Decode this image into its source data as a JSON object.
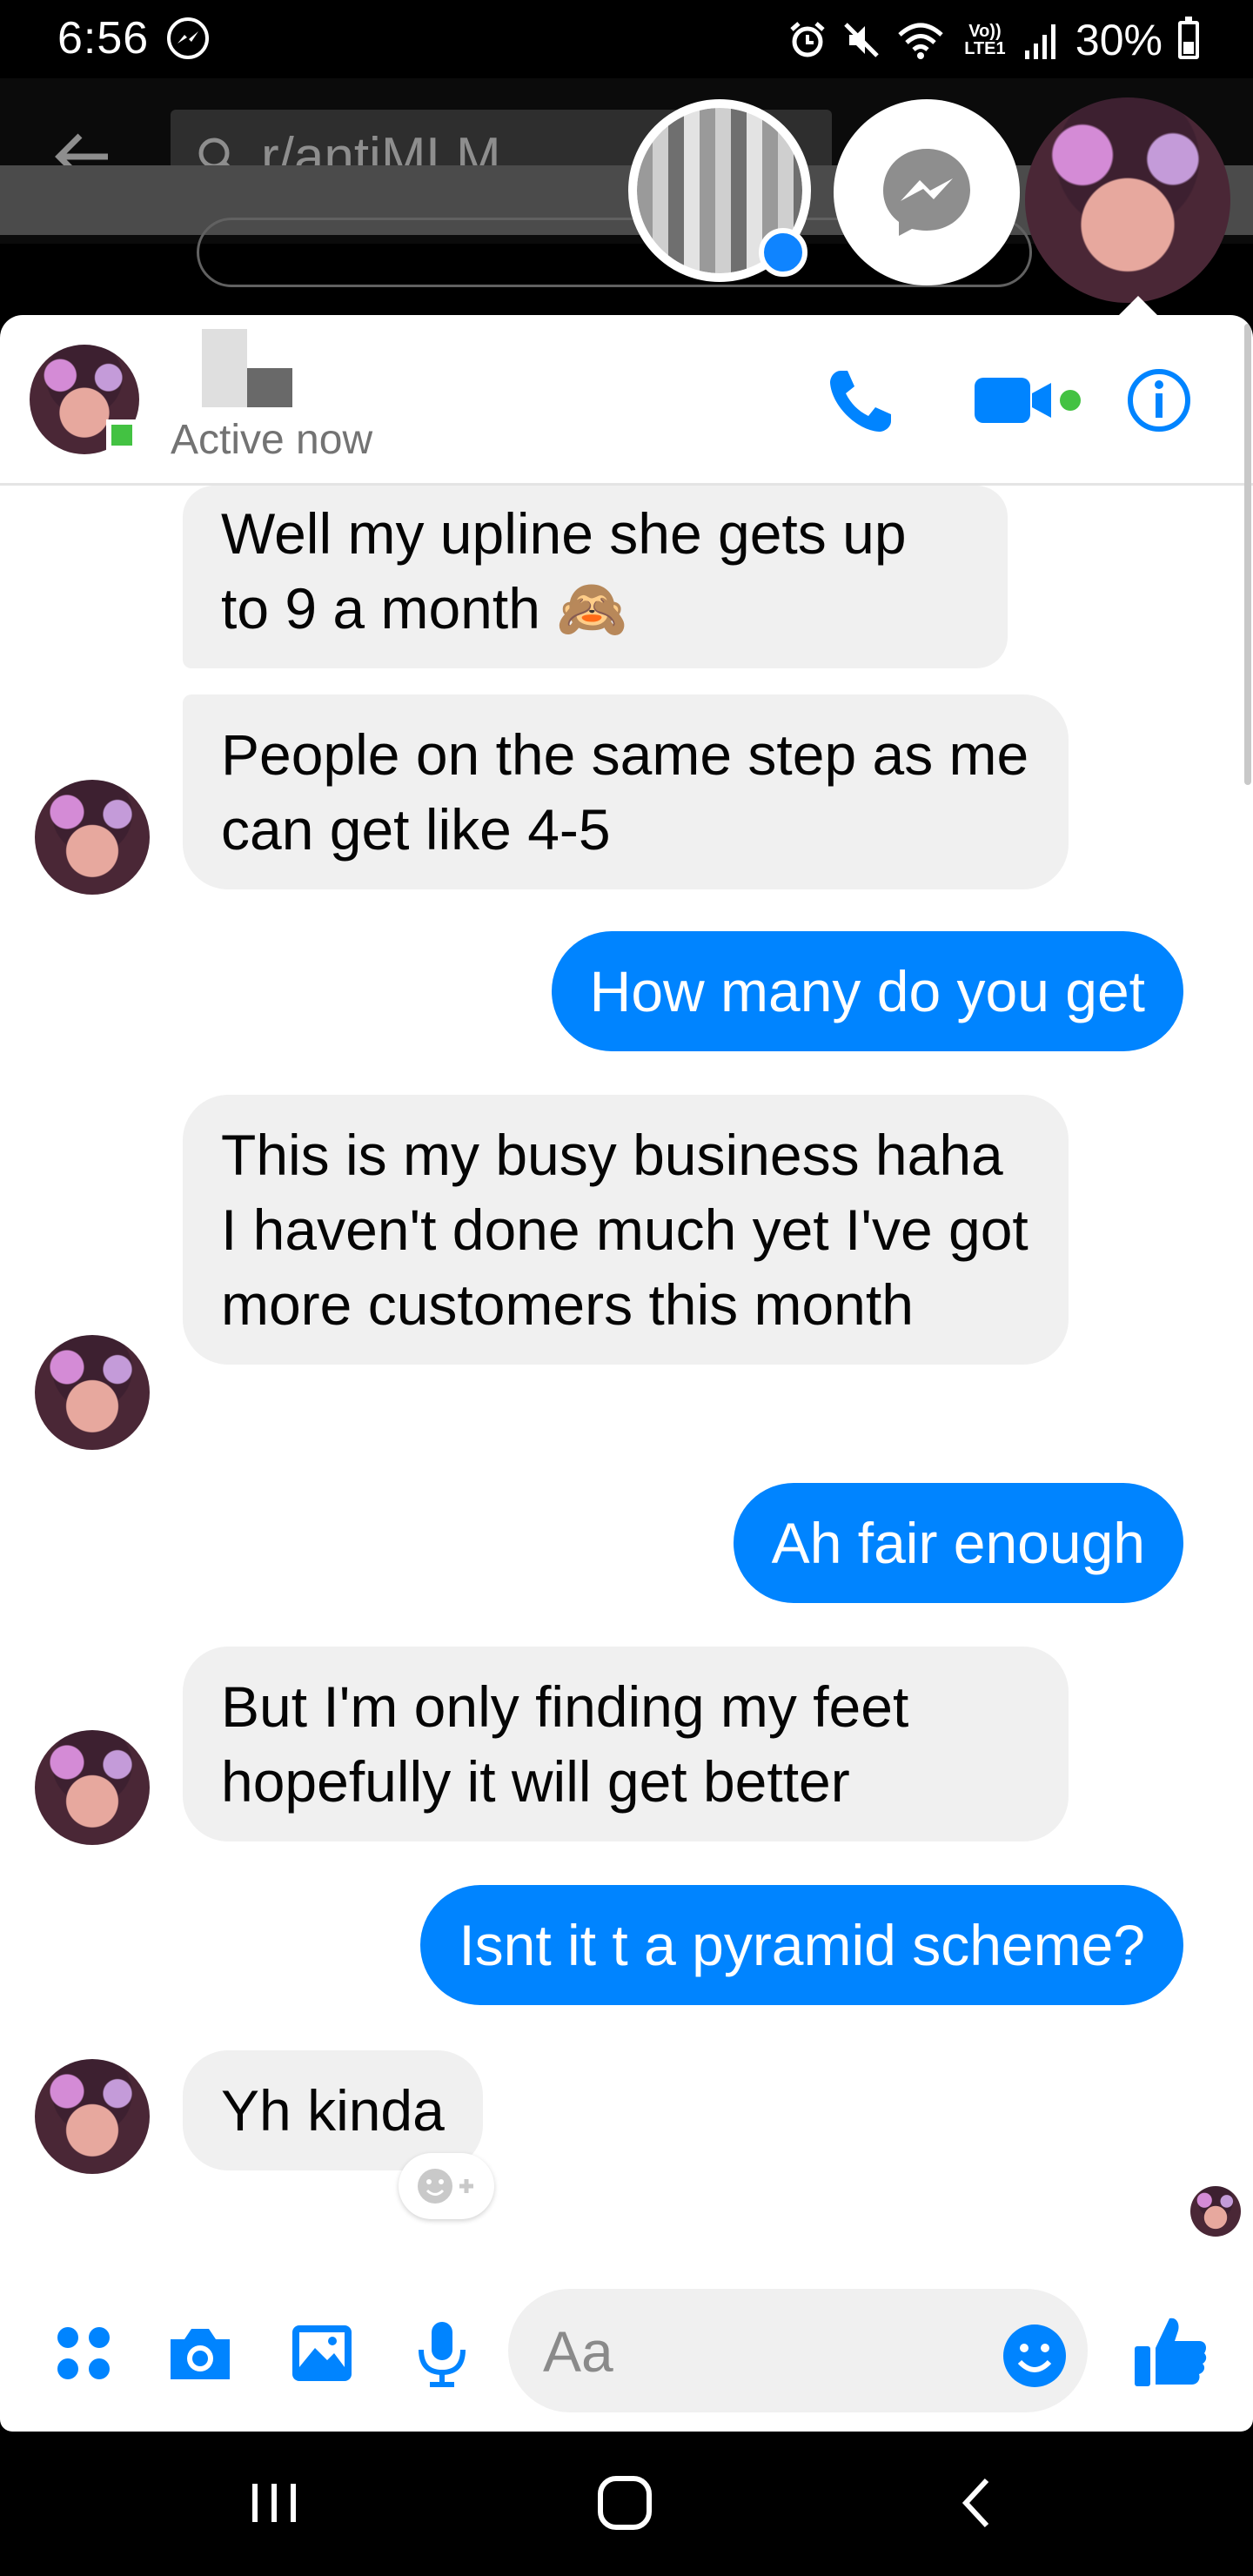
{
  "status_bar": {
    "time": "6:56",
    "network_label": "Vo)) LTE1",
    "battery_percent": "30%"
  },
  "background_app": {
    "search_text": "r/antiMLM"
  },
  "chat": {
    "header": {
      "status": "Active now"
    },
    "messages": [
      {
        "side": "in",
        "text": "Well my upline she gets up to 9 a month 🙈"
      },
      {
        "side": "in",
        "text": "People on the same step as me can get like 4-5"
      },
      {
        "side": "out",
        "text": "How many do you get"
      },
      {
        "side": "in",
        "text": "This is my busy business haha I haven't done much yet I've got more customers this month"
      },
      {
        "side": "out",
        "text": "Ah fair enough"
      },
      {
        "side": "in",
        "text": "But I'm only finding my feet hopefully it will get better"
      },
      {
        "side": "out",
        "text": "Isnt it t a pyramid scheme?"
      },
      {
        "side": "in",
        "text": "Yh kinda"
      }
    ],
    "composer": {
      "placeholder": "Aa"
    }
  },
  "colors": {
    "accent": "#0084ff",
    "incoming_bubble": "#f0f0f0",
    "online": "#43c242"
  },
  "icons": [
    "messenger-icon",
    "alarm-icon",
    "mute-icon",
    "wifi-icon",
    "signal-icon",
    "battery-icon",
    "back-arrow-icon",
    "search-icon",
    "phone-icon",
    "video-icon",
    "info-icon",
    "apps-icon",
    "camera-icon",
    "image-icon",
    "microphone-icon",
    "smiley-icon",
    "thumbs-up-icon",
    "recent-apps-icon",
    "home-icon",
    "back-icon"
  ]
}
